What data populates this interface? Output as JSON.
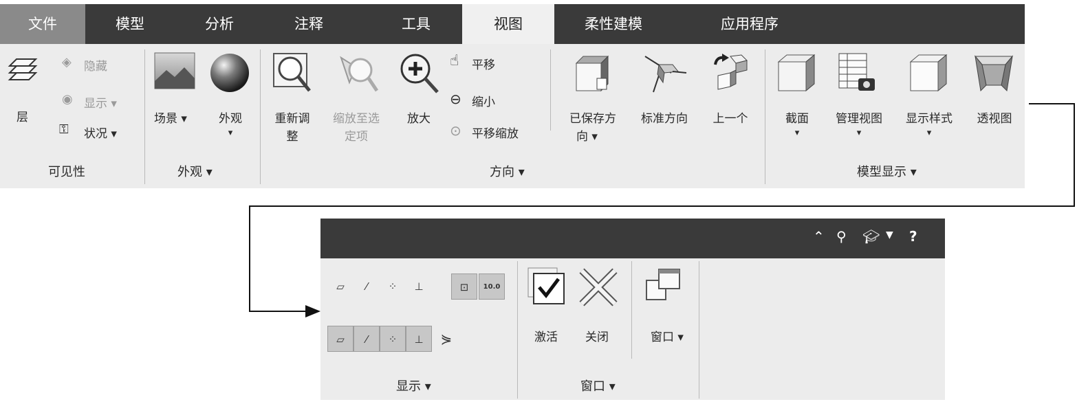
{
  "tabs": [
    "文件",
    "模型",
    "分析",
    "注释",
    "工具",
    "视图",
    "柔性建模",
    "应用程序"
  ],
  "active_tab": "视图",
  "visibility": {
    "layer": "层",
    "hide": "隐藏",
    "show": "显示 ▾",
    "status": "状况 ▾",
    "group": "可见性"
  },
  "appearance": {
    "scene": "场景 ▾",
    "look": "外观",
    "look_arrow": "▾",
    "group": "外观 ▾"
  },
  "orientation": {
    "refit_1": "重新调",
    "refit_2": "整",
    "zoom_sel_1": "缩放至选",
    "zoom_sel_2": "定项",
    "zoom_in": "放大",
    "pan": "平移",
    "zoom_out": "缩小",
    "pan_zoom": "平移缩放",
    "saved_1": "已保存方",
    "saved_2": "向 ▾",
    "standard": "标准方向",
    "previous": "上一个",
    "group": "方向 ▾"
  },
  "model_display": {
    "section": "截面",
    "manage": "管理视图",
    "style": "显示样式",
    "persp": "透视图",
    "arrow": "▾",
    "group": "模型显示 ▾"
  },
  "display_panel": {
    "group": "显示 ▾",
    "icons_row1": [
      "plane-display",
      "axis-display",
      "point-display",
      "csys-display",
      "annotation-display",
      "dimension-display"
    ],
    "icons_row2": [
      "plane-tag",
      "axis-tag",
      "point-tag",
      "csys-tag",
      "spin-center"
    ],
    "dim_value": "10.0"
  },
  "window_panel": {
    "activate": "激活",
    "close": "关闭",
    "windows": "窗口 ▾",
    "group": "窗口 ▾"
  },
  "header_icons": [
    "collapse-icon",
    "search-icon",
    "graduation-cap-icon",
    "dropdown-icon",
    "help-icon"
  ]
}
